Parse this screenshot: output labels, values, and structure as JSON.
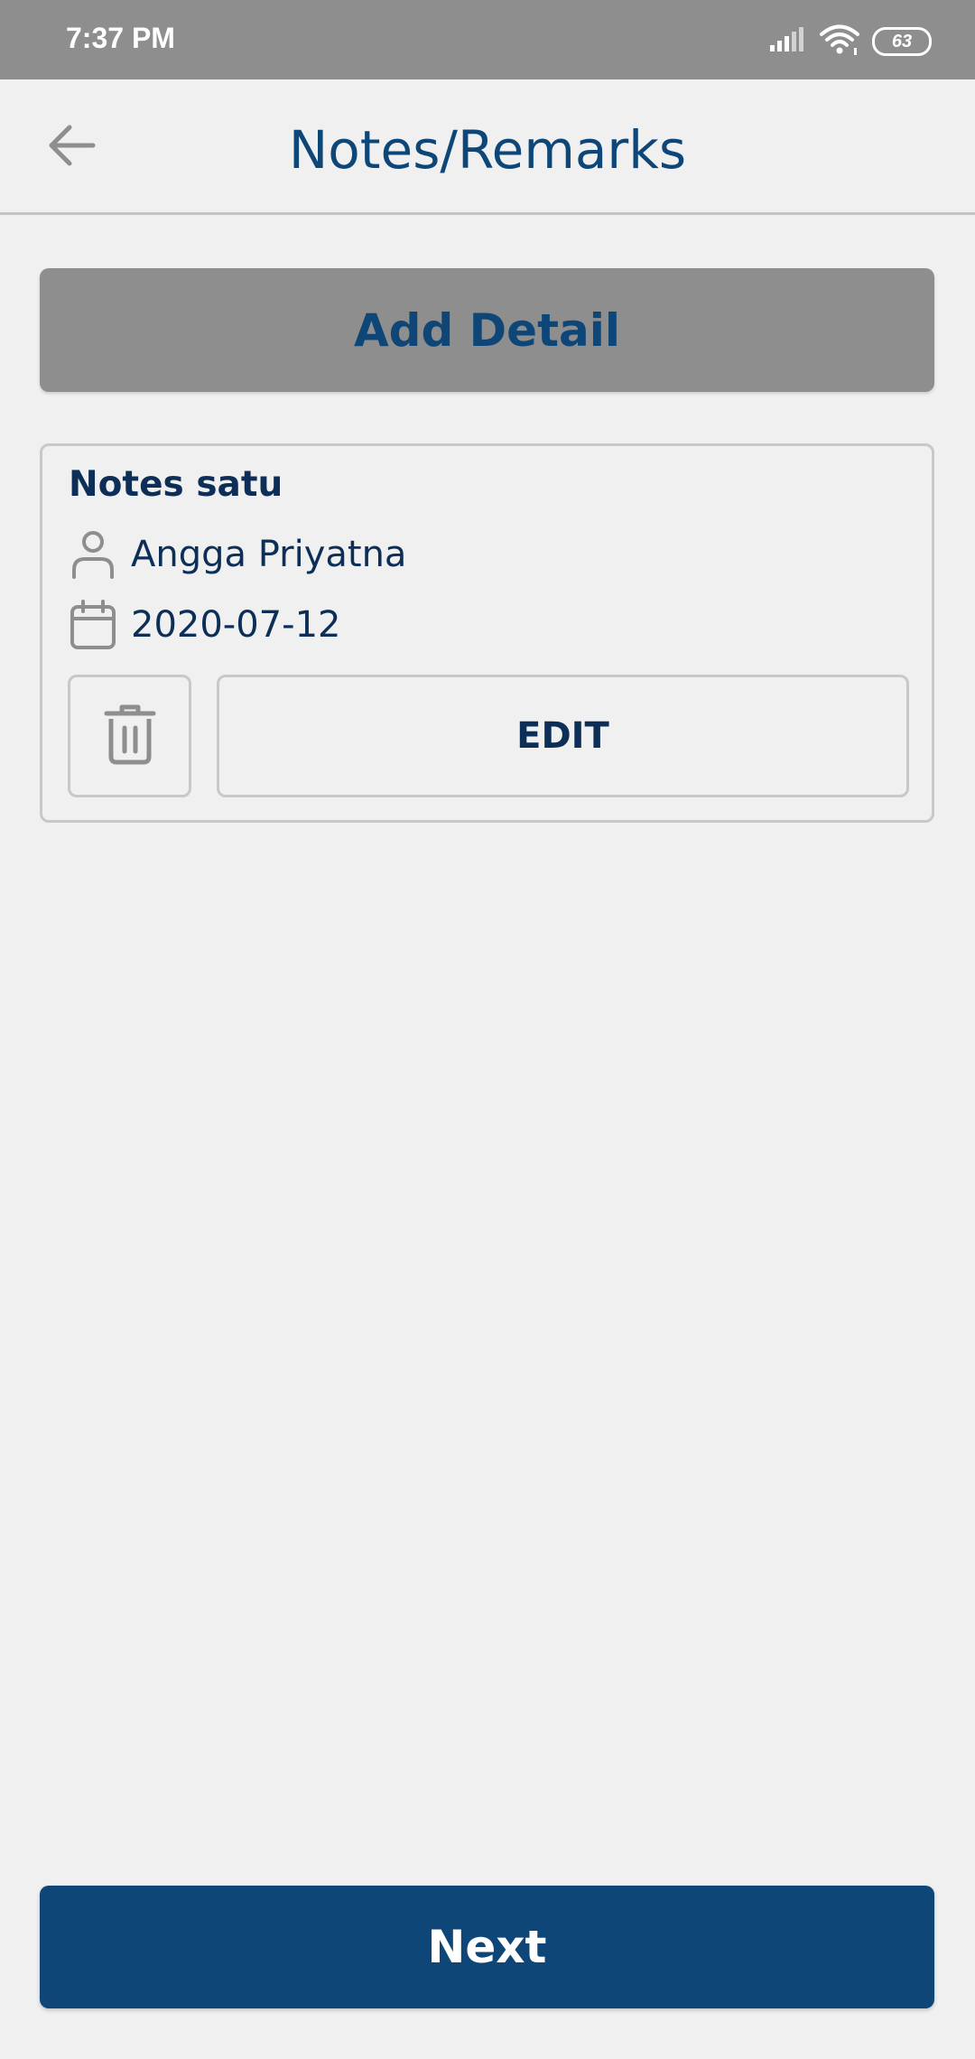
{
  "status_bar": {
    "time": "7:37 PM",
    "battery_level": "63",
    "icons": [
      "signal-icon",
      "wifi-icon",
      "battery-icon"
    ]
  },
  "app_bar": {
    "title": "Notes/Remarks",
    "back_icon": "back-arrow-icon"
  },
  "actions": {
    "add_detail_label": "Add Detail",
    "next_label": "Next"
  },
  "notes": [
    {
      "title": "Notes satu",
      "author": "Angga Priyatna",
      "date": "2020-07-12",
      "edit_label": "EDIT",
      "delete_icon": "trash-icon"
    }
  ],
  "colors": {
    "primary": "#0d4677",
    "text_dark": "#0c2e57",
    "status_bar": "#8e8e8e",
    "disabled_button": "#8e8e8e",
    "background": "#f0f0f0",
    "icon_gray": "#8e8e8e"
  }
}
